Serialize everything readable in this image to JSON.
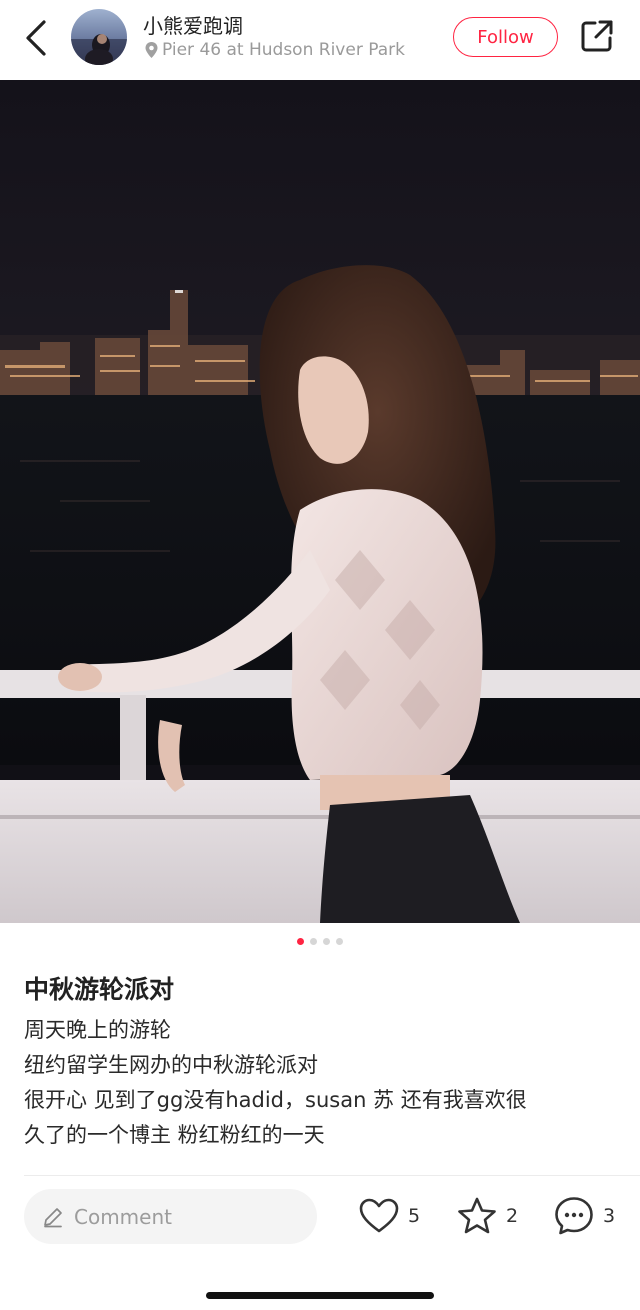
{
  "header": {
    "author_name": "小熊爱跑调",
    "location": "Pier 46 at Hudson River Park",
    "follow_label": "Follow"
  },
  "gallery": {
    "page_count": 4,
    "active_index": 0
  },
  "post": {
    "title": "中秋游轮派对",
    "lines": [
      "周天晚上的游轮",
      "纽约留学生网办的中秋游轮派对",
      "很开心 见到了gg没有hadid，susan 苏 还有我喜欢很",
      "久了的一个博主 粉红粉红的一天"
    ]
  },
  "actions": {
    "comment_placeholder": "Comment",
    "likes": "5",
    "collects": "2",
    "comments": "3"
  },
  "colors": {
    "accent": "#ff2442",
    "text": "#222222",
    "muted": "#9a9a9a"
  },
  "icons": [
    "back-arrow-icon",
    "location-pin-icon",
    "share-icon",
    "pencil-icon",
    "heart-icon",
    "star-icon",
    "chat-bubble-icon"
  ]
}
